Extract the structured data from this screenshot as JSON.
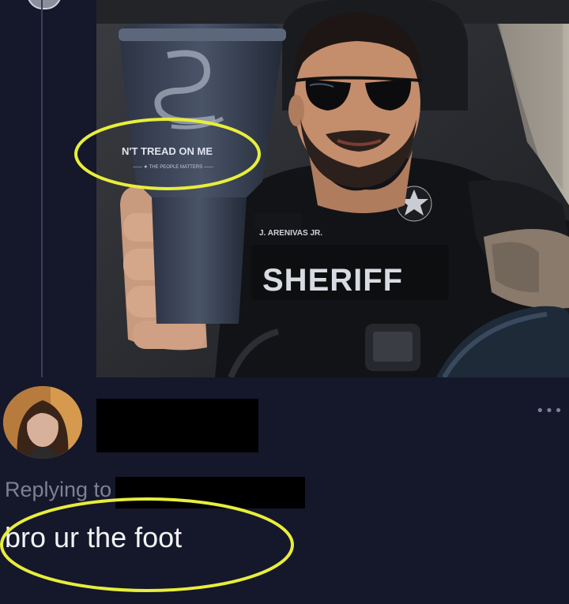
{
  "cup_engraving": {
    "line1": "N'T TREAD ON ME",
    "line2": "—— ★ THE PEOPLE MATTERS ——"
  },
  "vest": {
    "name_tag": "J. ARENIVAS JR.",
    "patch": "SHERIFF"
  },
  "reply": {
    "replying_to_label": "Replying to",
    "text": "bro ur the foot",
    "more_icon": "•••"
  },
  "colors": {
    "background": "#15172b",
    "highlight_ellipse": "#e8ee3a",
    "muted_text": "#7d8190",
    "body_text": "#f2f3f5"
  }
}
